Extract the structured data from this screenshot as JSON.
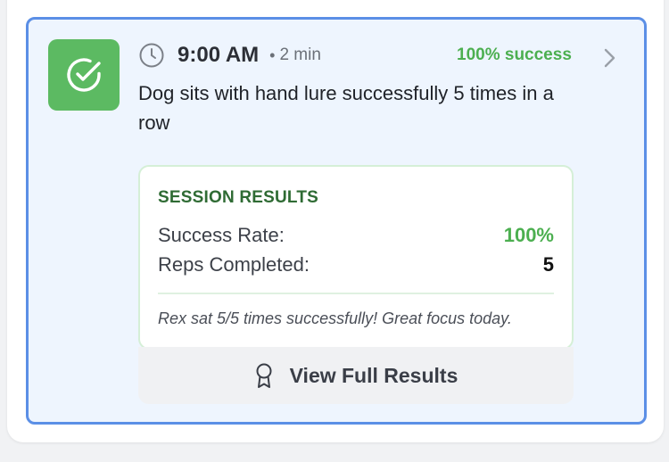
{
  "session": {
    "time": "9:00 AM",
    "separator": "•",
    "duration": "2 min",
    "success_label": "100% success",
    "title": "Dog sits with hand lure successfully 5 times in a row",
    "icons": {
      "status": "check-circle-icon",
      "clock": "clock-icon",
      "chevron": "chevron-right-icon",
      "award": "award-icon"
    },
    "colors": {
      "status_tile": "#5cba62",
      "success": "#4caf50",
      "border": "#5b8fe6",
      "card_bg": "#eef5fe"
    }
  },
  "results": {
    "heading": "SESSION RESULTS",
    "metrics": [
      {
        "label": "Success Rate:",
        "value": "100%",
        "color": "#4caf50"
      },
      {
        "label": "Reps Completed:",
        "value": "5",
        "color": "#111111"
      }
    ],
    "note": "Rex sat 5/5 times successfully! Great focus today."
  },
  "actions": {
    "view_full_results": "View Full Results"
  }
}
